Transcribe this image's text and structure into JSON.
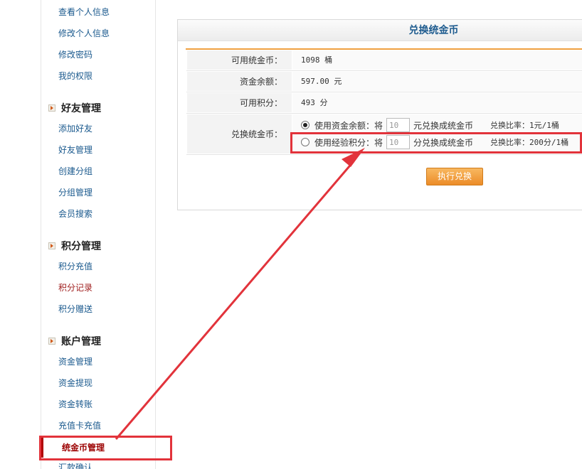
{
  "sidebar": {
    "items_top": [
      "查看个人信息",
      "修改个人信息",
      "修改密码",
      "我的权限"
    ],
    "sections": [
      {
        "title": "好友管理",
        "items": [
          "添加好友",
          "好友管理",
          "创建分组",
          "分组管理",
          "会员搜索"
        ]
      },
      {
        "title": "积分管理",
        "items": [
          "积分充值",
          "积分记录",
          "积分赠送"
        ]
      },
      {
        "title": "账户管理",
        "items": [
          "资金管理",
          "资金提现",
          "资金转账",
          "充值卡充值"
        ]
      }
    ],
    "active_item": "统金币管理",
    "cutoff_item": "汇款确认"
  },
  "panel": {
    "title": "兑换统金币",
    "rows": [
      {
        "label": "可用统金币：",
        "value": "1098 桶"
      },
      {
        "label": "资金余额：",
        "value": "597.00 元"
      },
      {
        "label": "可用积分：",
        "value": "493 分"
      }
    ],
    "exchange": {
      "label": "兑换统金币：",
      "option1": {
        "text": "使用资金余额：将",
        "input": "10",
        "suffix": "元兑换成统金币",
        "rate": "兑换比率：1元/1桶",
        "checked": true
      },
      "option2": {
        "text": "使用经验积分：将",
        "input": "10",
        "suffix": "分兑换成统金币",
        "rate": "兑换比率：200分/1桶",
        "checked": false
      }
    },
    "submit_label": "执行兑换"
  },
  "colors": {
    "annotation": "#e2333b",
    "accent": "#f0a040",
    "title": "#1f5c8f"
  }
}
